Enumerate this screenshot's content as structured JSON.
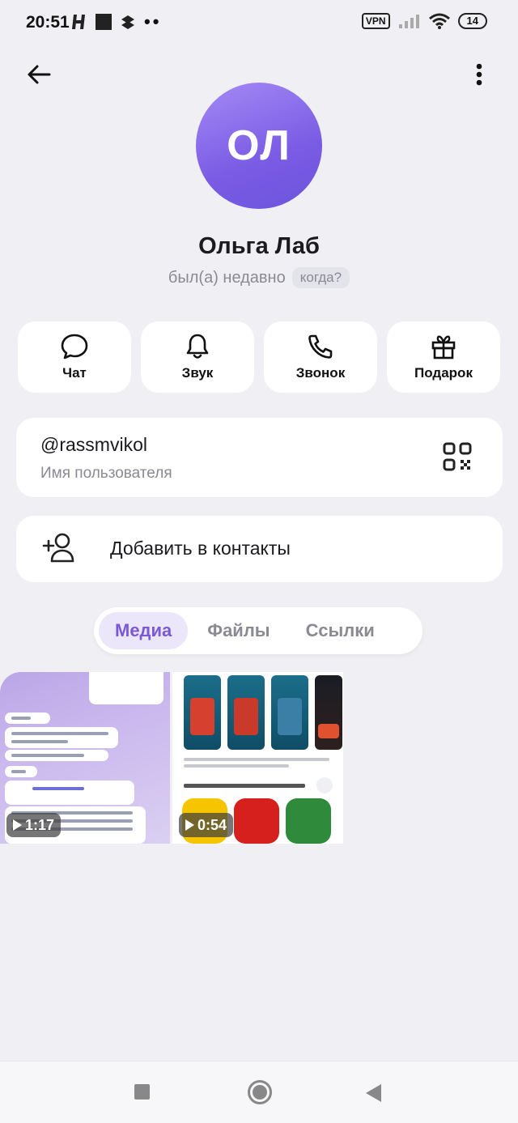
{
  "status_bar": {
    "time": "20:51",
    "left_icons": [
      "h-icon",
      "square-icon",
      "dropbox-icon"
    ],
    "more": "••",
    "vpn": "VPN",
    "battery": "14"
  },
  "header": {
    "back_icon": "arrow-left-icon",
    "menu_icon": "more-vertical-icon"
  },
  "profile": {
    "initials": "ОЛ",
    "name": "Ольга Лаб",
    "last_seen": "был(а) недавно",
    "when_chip": "когда?",
    "avatar_gradient": [
      "#a58af6",
      "#6c54dc"
    ]
  },
  "actions": [
    {
      "label": "Чат",
      "icon": "chat-bubble-icon"
    },
    {
      "label": "Звук",
      "icon": "bell-icon"
    },
    {
      "label": "Звонок",
      "icon": "phone-icon"
    },
    {
      "label": "Подарок",
      "icon": "gift-icon"
    }
  ],
  "username_card": {
    "username": "@rassmvikol",
    "caption": "Имя пользователя",
    "qr_icon": "qr-code-icon"
  },
  "add_contact": {
    "label": "Добавить в контакты",
    "icon": "add-user-icon"
  },
  "tabs": [
    {
      "label": "Медиа",
      "active": true
    },
    {
      "label": "Файлы",
      "active": false
    },
    {
      "label": "Ссылки",
      "active": false
    }
  ],
  "media": [
    {
      "duration": "1:17"
    },
    {
      "duration": "0:54"
    }
  ],
  "colors": {
    "accent": "#7a58d6",
    "accent_bg": "#ece6fb",
    "background": "#f0f0f4",
    "muted_text": "#8a8a93"
  },
  "navbar": {
    "icons": [
      "recent-apps-icon",
      "home-icon",
      "back-triangle-icon"
    ]
  }
}
